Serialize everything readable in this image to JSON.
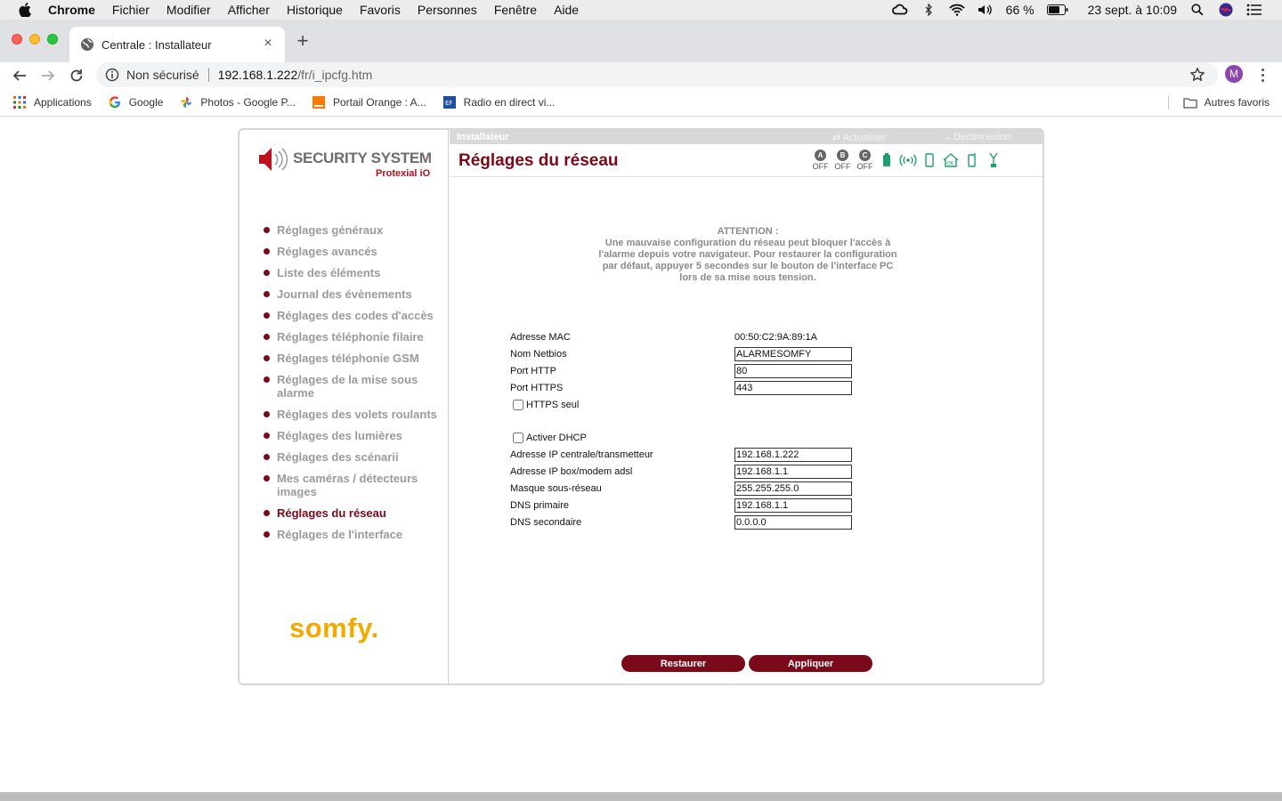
{
  "menubar": {
    "app_name": "Chrome",
    "items": [
      "Fichier",
      "Modifier",
      "Afficher",
      "Historique",
      "Favoris",
      "Personnes",
      "Fenêtre",
      "Aide"
    ],
    "battery": "66 %",
    "datetime": "23 sept. à 10:09"
  },
  "browser": {
    "tab_title": "Centrale  : Installateur",
    "url_security": "Non sécurisé",
    "url_host": "192.168.1.222",
    "url_path": "/fr/i_ipcfg.htm",
    "profile_initial": "M",
    "bookmarks": [
      "Applications",
      "Google",
      "Photos - Google P...",
      "Portail Orange : A...",
      "Radio en direct vi..."
    ],
    "other_bookmarks": "Autres favoris"
  },
  "app": {
    "brand": "SECURITY SYSTEM",
    "product": "Protexial iO",
    "footer_brand": "somfy.",
    "role": "Installateur",
    "refresh_label": "Actualiser",
    "logout_label": "Deconnexion",
    "page_title": "Réglages du réseau",
    "zones": [
      {
        "letter": "A",
        "state": "OFF"
      },
      {
        "letter": "B",
        "state": "OFF"
      },
      {
        "letter": "C",
        "state": "OFF"
      }
    ],
    "nav": [
      "Réglages généraux",
      "Réglages avancés",
      "Liste des éléments",
      "Journal des évènements",
      "Réglages des codes d'accès",
      "Réglages téléphonie filaire",
      "Réglages téléphonie GSM",
      "Réglages de la mise sous alarme",
      "Réglages des volets roulants",
      "Réglages des lumières",
      "Réglages des scénarii",
      "Mes caméras / détecteurs images",
      "Réglages du réseau",
      "Réglages de l'interface"
    ],
    "warning_title": "ATTENTION :",
    "warning_text": "Une mauvaise configuration du réseau peut bloquer l'accès à l'alarme depuis votre navigateur. Pour restaurer la configuration par défaut, appuyer 5 secondes sur le bouton de l'interface PC lors de sa mise sous tension.",
    "form": {
      "mac_label": "Adresse MAC",
      "mac_value": "00:50:C2:9A:89:1A",
      "netbios_label": "Nom Netbios",
      "netbios_value": "ALARMESOMFY",
      "http_label": "Port HTTP",
      "http_value": "80",
      "https_label": "Port HTTPS",
      "https_value": "443",
      "https_only_label": "HTTPS seul",
      "dhcp_label": "Activer DHCP",
      "ip_label": "Adresse IP centrale/transmetteur",
      "ip_value": "192.168.1.222",
      "gateway_label": "Adresse IP box/modem adsl",
      "gateway_value": "192.168.1.1",
      "mask_label": "Masque sous-réseau",
      "mask_value": "255.255.255.0",
      "dns1_label": "DNS primaire",
      "dns1_value": "192.168.1.1",
      "dns2_label": "DNS secondaire",
      "dns2_value": "0.0.0.0"
    },
    "buttons": {
      "restore": "Restaurer",
      "apply": "Appliquer"
    }
  },
  "colors": {
    "brand_red": "#7a0a1a",
    "nav_gray": "#9b9b9b",
    "somfy_yellow": "#f2a900",
    "status_green": "#1f9e6e"
  }
}
